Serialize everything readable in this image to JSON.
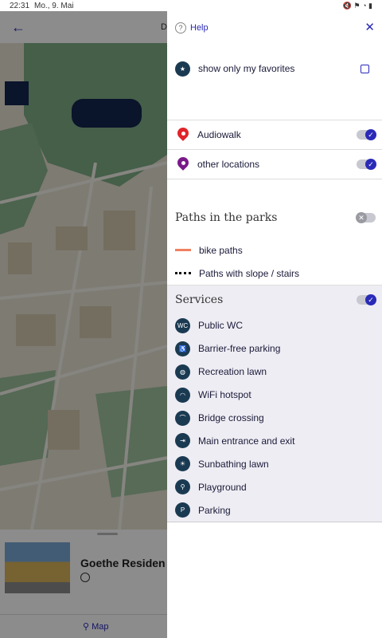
{
  "status_bar": {
    "time": "22:31",
    "date": "Mo., 9. Mai"
  },
  "app": {
    "title_partial": "De",
    "place_name": "Goethe Residen",
    "nav_map_label": "Map"
  },
  "drawer": {
    "help_label": "Help",
    "favorites_label": "show only my favorites",
    "layers": [
      {
        "label": "Audiowalk",
        "color": "#e0242a",
        "enabled": true
      },
      {
        "label": "other locations",
        "color": "#7a1a8a",
        "enabled": true
      }
    ],
    "paths": {
      "title": "Paths in the parks",
      "enabled": false,
      "items": [
        {
          "label": "bike paths"
        },
        {
          "label": "Paths with slope / stairs"
        }
      ]
    },
    "services": {
      "title": "Services",
      "enabled": true,
      "items": [
        {
          "label": "Public WC",
          "icon": "wc-icon",
          "glyph": "WC"
        },
        {
          "label": "Barrier-free parking",
          "icon": "wheelchair-icon",
          "glyph": "♿"
        },
        {
          "label": "Recreation lawn",
          "icon": "ball-icon",
          "glyph": "◍"
        },
        {
          "label": "WiFi hotspot",
          "icon": "wifi-icon",
          "glyph": "◠"
        },
        {
          "label": "Bridge crossing",
          "icon": "bridge-icon",
          "glyph": "⌒"
        },
        {
          "label": "Main entrance and exit",
          "icon": "entrance-icon",
          "glyph": "⇥"
        },
        {
          "label": "Sunbathing lawn",
          "icon": "sunbathing-icon",
          "glyph": "☀"
        },
        {
          "label": "Playground",
          "icon": "playground-icon",
          "glyph": "⚲"
        },
        {
          "label": "Parking",
          "icon": "parking-icon",
          "glyph": "P"
        }
      ]
    }
  }
}
